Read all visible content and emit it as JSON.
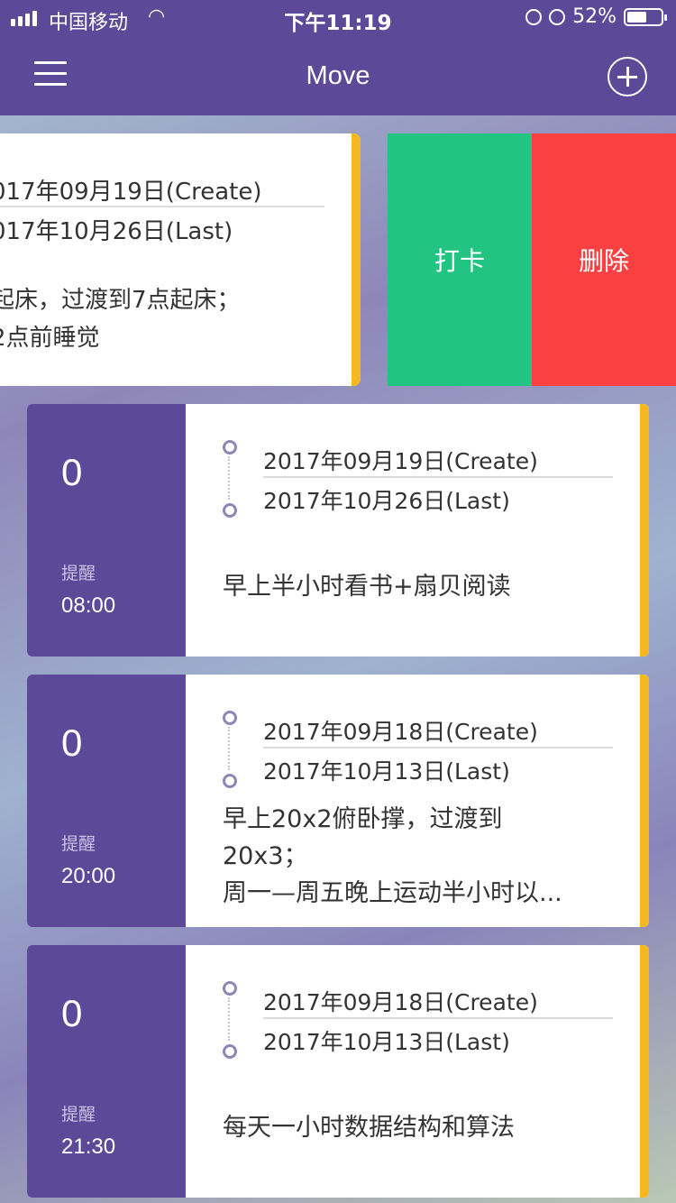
{
  "status_bar": {
    "carrier": "中国移动",
    "time": "下午11:19",
    "battery": "52%"
  },
  "nav": {
    "title": "Move"
  },
  "swiped_card": {
    "created": "017年09月19日(Create)",
    "last": "017年10月26日(Last)",
    "task_line1": "起床，过渡到7点起床；",
    "task_line2": "2点前睡觉",
    "actions": {
      "checkin": "打卡",
      "delete": "删除"
    }
  },
  "habits": [
    {
      "count": "0",
      "reminder_label": "提醒",
      "reminder_time": "08:00",
      "created": "2017年09月19日(Create)",
      "last": "2017年10月26日(Last)",
      "task_line1": "早上半小时看书+扇贝阅读",
      "task_line2": "",
      "task_line3": ""
    },
    {
      "count": "0",
      "reminder_label": "提醒",
      "reminder_time": "20:00",
      "created": "2017年09月18日(Create)",
      "last": "2017年10月13日(Last)",
      "task_line1": "早上20x2俯卧撑，过渡到",
      "task_line2": "20x3；",
      "task_line3": "周一—周五晚上运动半小时以..."
    },
    {
      "count": "0",
      "reminder_label": "提醒",
      "reminder_time": "21:30",
      "created": "2017年09月18日(Create)",
      "last": "2017年10月13日(Last)",
      "task_line1": "每天一小时数据结构和算法",
      "task_line2": "",
      "task_line3": ""
    }
  ],
  "colors": {
    "header": "#5c4a99",
    "accent": "#f6b820",
    "checkin": "#22c482",
    "delete": "#fb4042"
  }
}
